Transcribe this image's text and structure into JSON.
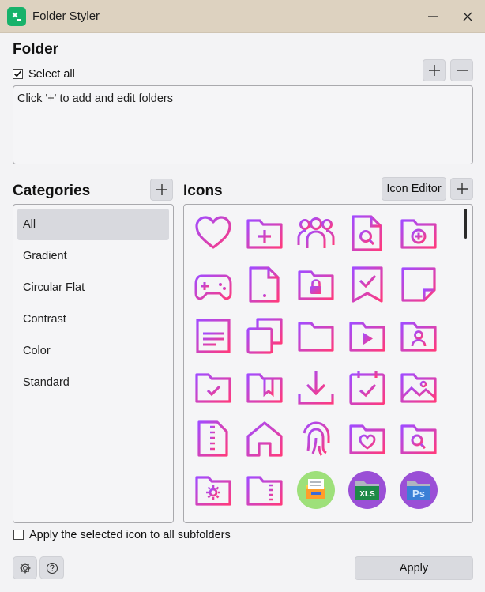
{
  "window": {
    "title": "Folder Styler"
  },
  "folder": {
    "heading": "Folder",
    "select_all_label": "Select all",
    "select_all_checked": true,
    "hint": "Click '+' to add and edit folders"
  },
  "categories": {
    "heading": "Categories",
    "items": [
      "All",
      "Gradient",
      "Circular Flat",
      "Contrast",
      "Color",
      "Standard"
    ],
    "selected": "All"
  },
  "icons": {
    "heading": "Icons",
    "editor_label": "Icon Editor",
    "xls_badge": "XLS",
    "ps_badge": "Ps",
    "grid": [
      [
        "heart-icon",
        "folder-add-icon",
        "users-icon",
        "file-search-icon",
        "folder-health-icon"
      ],
      [
        "gamepad-icon",
        "file-alert-icon",
        "folder-lock-icon",
        "bookmark-check-icon",
        "sticky-note-icon"
      ],
      [
        "document-text-icon",
        "copy-icon",
        "folder-minus-icon",
        "folder-play-icon",
        "folder-user-icon"
      ],
      [
        "folder-check-icon",
        "folder-bookmark-icon",
        "download-icon",
        "calendar-check-icon",
        "folder-image-icon"
      ],
      [
        "file-zip-icon",
        "home-icon",
        "fingerprint-icon",
        "folder-heart-icon",
        "folder-search-icon"
      ],
      [
        "folder-settings-icon",
        "folder-zip-icon",
        "archive-folder-icon",
        "xls-folder-icon",
        "photoshop-folder-icon"
      ]
    ]
  },
  "footer": {
    "apply_subfolders_label": "Apply the selected icon to all subfolders",
    "apply_subfolders_checked": false,
    "apply_label": "Apply"
  },
  "colors": {
    "titlebar": "#ddd2c0",
    "app_icon": "#17b26a",
    "gradient_start": "#a24bff",
    "gradient_end": "#ff3a7d"
  }
}
